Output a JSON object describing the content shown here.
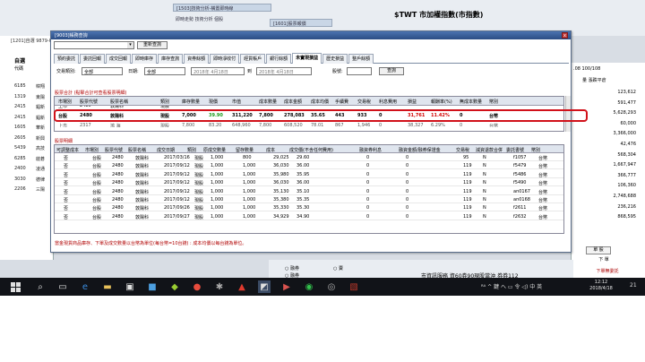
{
  "background": {
    "tab_a": "[1503]技術分析-橫置即時線",
    "tab_b": "即時走勢 技術分析  個股",
    "tab_c": "[1601]股票報價",
    "index_title": "$TWT 市加權指數(市指數)",
    "left_header": "[1201]自選  9879-007371-6",
    "left_row1": "自選",
    "left_row2": "代碼",
    "left_codes": [
      {
        "code": "6185",
        "name": "幃翔"
      },
      {
        "code": "1319",
        "name": "東陽"
      },
      {
        "code": "2415",
        "name": "錩新"
      },
      {
        "code": "2415",
        "name": "錩新"
      },
      {
        "code": "1605",
        "name": "華新"
      },
      {
        "code": "2605",
        "name": "新興"
      },
      {
        "code": "5439",
        "name": "高技"
      },
      {
        "code": "6285",
        "name": "啟碁"
      },
      {
        "code": "2400",
        "name": "凌通"
      },
      {
        "code": "3030",
        "name": "德律"
      },
      {
        "code": "2206",
        "name": "三陽"
      }
    ],
    "right_header": ".08  100/108",
    "right_sub": "量 漲跌平倉",
    "right_values": [
      "123,612",
      "591,477",
      "5,628,293",
      "60,000",
      "3,366,000",
      "42,476",
      "568,304",
      "1,667,947",
      "366,777",
      "106,360",
      "2,748,688",
      "236,216",
      "868,595"
    ],
    "radio_1": "○ 融券",
    "radio_2": "○ 賣",
    "radio_3": "○ 融券",
    "bottom_msg": "市資訊服務 資60券90現股當沖 券券112",
    "btn_1": "單 股",
    "btn_2": "下 單",
    "btn_3": "下單無委託"
  },
  "dialog": {
    "title": "[9003]帳務查詢",
    "close": "x",
    "query_button": "重新查詢",
    "tabs": [
      "預約委託",
      "委託回報",
      "成交回報",
      "即時庫存",
      "庫存查詢",
      "資券餘額",
      "即時淨收付",
      "經貨帳戶",
      "銀行餘額",
      "未實現損益",
      "歷史損益",
      "整戶餘額"
    ],
    "active_tab": 9,
    "filter": {
      "type_label": "交易類別:",
      "type_value": "全部",
      "date_label": "日期:",
      "date_type": "全部",
      "date_from": "2018年 4月18日",
      "date_to_label": "到",
      "date_to": "2018年 4月18日",
      "stock_label": "股號:",
      "stock_value": "",
      "search_button": "查詢"
    },
    "summary_title": "股票合計 (點擊合計可查看股票明細)",
    "summary_headers": [
      "市場別",
      "股票代號",
      "股票名稱",
      "類別",
      "庫存數量",
      "現價",
      "市值",
      "成本數量",
      "成本金額",
      "成本均價",
      "手續費",
      "交易稅",
      "利息費用",
      "損益",
      "報酬率(%)",
      "無成本數量",
      "幣別"
    ],
    "summary_partial_row": [
      "上市",
      "2480",
      "敦陽科",
      "現股"
    ],
    "summary_row": [
      "台股",
      "2480",
      "敦陽科",
      "現股",
      "7,000",
      "39.90",
      "311,220",
      "7,800",
      "278,083",
      "35.65",
      "443",
      "933",
      "0",
      "31,761",
      "11.42%",
      "0",
      "台幣"
    ],
    "summary_partial_row2": [
      "上市",
      "2317",
      "鴻 海",
      "現股",
      "7,800",
      "83.20",
      "648,960",
      "7,800",
      "608,520",
      "78.01",
      "867",
      "1,946",
      "0",
      "38,327",
      "6.29%",
      "0",
      "台幣"
    ],
    "detail_title": "股票明細",
    "detail_headers": [
      "可調整成本",
      "市場別",
      "股票代號",
      "股票名稱",
      "成交日期",
      "類別",
      "原成交數量",
      "留存數量",
      "成本",
      "成交價(不含任何費用)",
      "融資券利息",
      "融資金額/融券保證金",
      "交易稅",
      "減資退款合併",
      "委託書號",
      "幣別"
    ],
    "detail_rows": [
      [
        "否",
        "台股",
        "2480",
        "敦陽科",
        "2017/03/16",
        "現股",
        "1,000",
        "800",
        "29,025",
        "29.60",
        "0",
        "0",
        "95",
        "N",
        "f1057",
        "台幣"
      ],
      [
        "否",
        "台股",
        "2480",
        "敦陽科",
        "2017/09/12",
        "現股",
        "1,000",
        "1,000",
        "36,030",
        "36.00",
        "0",
        "0",
        "119",
        "N",
        "f5479",
        "台幣"
      ],
      [
        "否",
        "台股",
        "2480",
        "敦陽科",
        "2017/09/12",
        "現股",
        "1,000",
        "1,000",
        "35,980",
        "35.95",
        "0",
        "0",
        "119",
        "N",
        "f5486",
        "台幣"
      ],
      [
        "否",
        "台股",
        "2480",
        "敦陽科",
        "2017/09/12",
        "現股",
        "1,000",
        "1,000",
        "36,030",
        "36.00",
        "0",
        "0",
        "119",
        "N",
        "f5490",
        "台幣"
      ],
      [
        "否",
        "台股",
        "2480",
        "敦陽科",
        "2017/09/12",
        "現股",
        "1,000",
        "1,000",
        "35,130",
        "35.10",
        "0",
        "0",
        "119",
        "N",
        "an0167",
        "台幣"
      ],
      [
        "否",
        "台股",
        "2480",
        "敦陽科",
        "2017/09/12",
        "現股",
        "1,000",
        "1,000",
        "35,380",
        "35.35",
        "0",
        "0",
        "119",
        "N",
        "an0168",
        "台幣"
      ],
      [
        "否",
        "台股",
        "2480",
        "敦陽科",
        "2017/09/26",
        "現股",
        "1,000",
        "1,000",
        "35,330",
        "35.30",
        "0",
        "0",
        "119",
        "N",
        "f2611",
        "台幣"
      ],
      [
        "否",
        "台股",
        "2480",
        "敦陽科",
        "2017/09/27",
        "現股",
        "1,000",
        "1,000",
        "34,929",
        "34.90",
        "0",
        "0",
        "119",
        "N",
        "f2632",
        "台幣"
      ]
    ],
    "footer_note": "當金現貨商品庫存、下單及成交數量以台幣為單位(每台幣=10台錢) : 成本均價以每台錢為單位。"
  },
  "taskbar": {
    "tray_text": "ᴿᴬ ^ 鍵 へ ▭ 令 ◁) 中 英",
    "lang": "英",
    "time": "12:12",
    "date": "2018/4/18",
    "notify": "21"
  }
}
